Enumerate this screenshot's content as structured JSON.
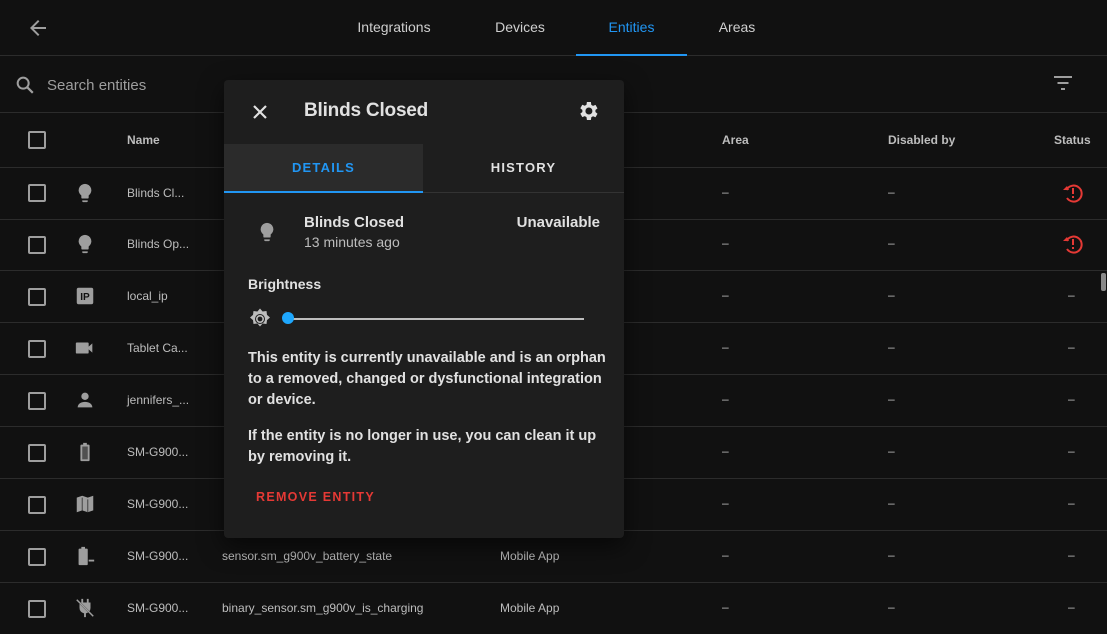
{
  "nav": {
    "tabs": [
      {
        "label": "Integrations"
      },
      {
        "label": "Devices"
      },
      {
        "label": "Entities",
        "active": true
      },
      {
        "label": "Areas"
      }
    ]
  },
  "search": {
    "placeholder": "Search entities"
  },
  "table": {
    "headers": {
      "name": "Name",
      "area": "Area",
      "disabled_by": "Disabled by",
      "status": "Status"
    },
    "rows": [
      {
        "icon": "lightbulb-icon",
        "name": "Blinds Cl...",
        "entity_id": "",
        "integration": "",
        "area": "–",
        "disabled_by": "–",
        "status": "restore-alert-icon"
      },
      {
        "icon": "lightbulb-icon",
        "name": "Blinds Op...",
        "entity_id": "",
        "integration": "",
        "area": "–",
        "disabled_by": "–",
        "status": "restore-alert-icon"
      },
      {
        "icon": "ip-icon",
        "name": "local_ip",
        "entity_id": "",
        "integration": "",
        "area": "–",
        "disabled_by": "–",
        "status": "–"
      },
      {
        "icon": "video-camera-icon",
        "name": "Tablet Ca...",
        "entity_id": "",
        "integration": "",
        "area": "–",
        "disabled_by": "–",
        "status": "–"
      },
      {
        "icon": "person-icon",
        "name": "jennifers_...",
        "entity_id": "",
        "integration": "",
        "area": "–",
        "disabled_by": "–",
        "status": "–"
      },
      {
        "icon": "battery-icon",
        "name": "SM-G900...",
        "entity_id": "",
        "integration": "",
        "area": "–",
        "disabled_by": "–",
        "status": "–"
      },
      {
        "icon": "map-icon",
        "name": "SM-G900...",
        "entity_id": "",
        "integration": "",
        "area": "–",
        "disabled_by": "–",
        "status": "–"
      },
      {
        "icon": "battery-minus-icon",
        "name": "SM-G900...",
        "entity_id": "sensor.sm_g900v_battery_state",
        "integration": "Mobile App",
        "area": "–",
        "disabled_by": "–",
        "status": "–"
      },
      {
        "icon": "power-plug-off-icon",
        "name": "SM-G900...",
        "entity_id": "binary_sensor.sm_g900v_is_charging",
        "integration": "Mobile App",
        "area": "–",
        "disabled_by": "–",
        "status": "–"
      }
    ]
  },
  "dialog": {
    "title": "Blinds Closed",
    "tabs": [
      {
        "label": "DETAILS",
        "active": true
      },
      {
        "label": "HISTORY"
      }
    ],
    "entity": {
      "name": "Blinds Closed",
      "last_changed": "13 minutes ago",
      "state": "Unavailable",
      "icon": "lightbulb-icon"
    },
    "brightness": {
      "label": "Brightness",
      "value": 0
    },
    "message1": "This entity is currently unavailable and is an orphan to a removed, changed or dysfunctional integration or device.",
    "message2": "If the entity is no longer in use, you can clean it up by removing it.",
    "remove_label": "REMOVE ENTITY"
  },
  "colors": {
    "accent": "#2196f3",
    "danger": "#e53935",
    "background": "#111111",
    "dialog": "#1e1e1e"
  }
}
